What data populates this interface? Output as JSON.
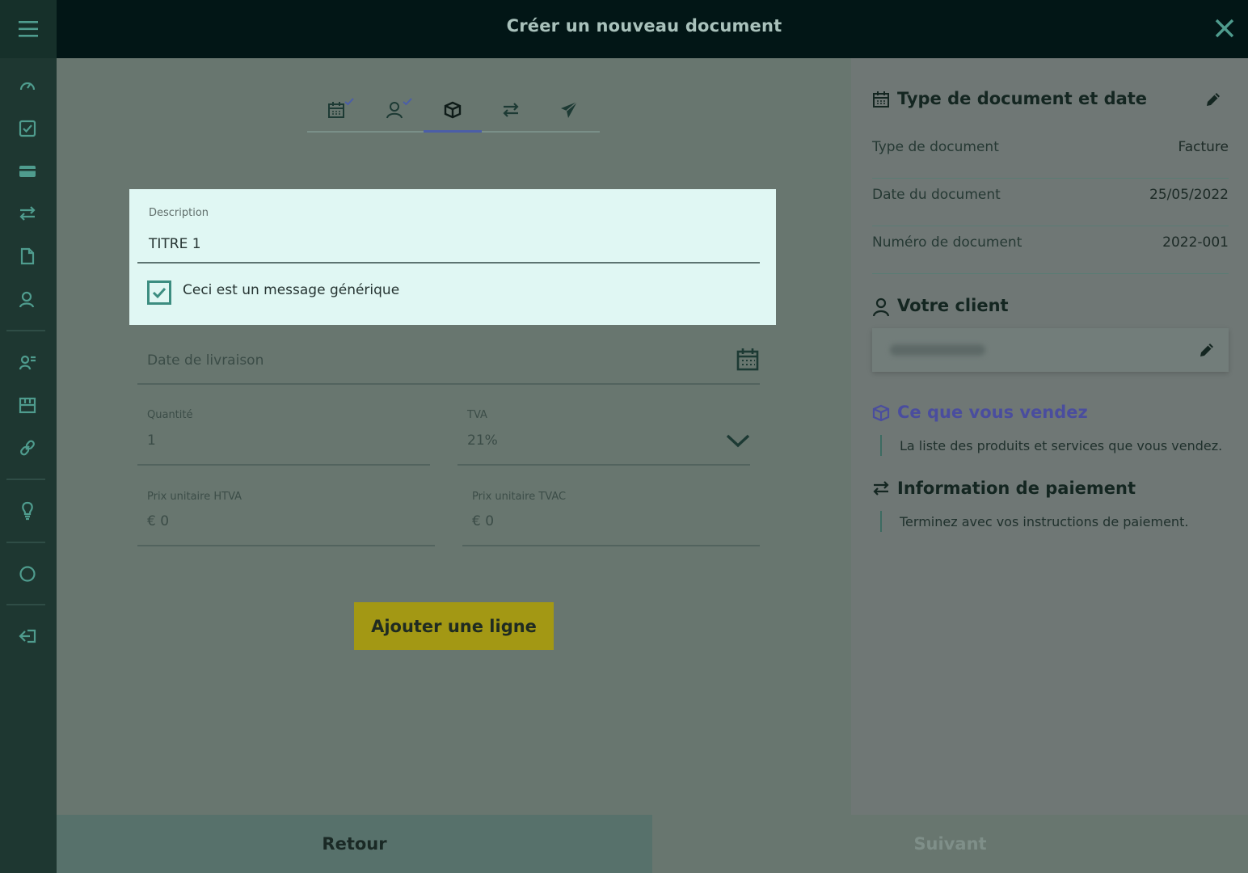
{
  "header": {
    "title": "Créer un nouveau document"
  },
  "sidebar": {
    "icons": [
      "menu-icon",
      "dashboard-icon",
      "checkbox-icon",
      "card-icon",
      "transfer-icon",
      "document-icon",
      "client-icon",
      "contacts-icon",
      "catalog-icon",
      "link-icon",
      "bulb-icon",
      "circle-icon",
      "logout-icon"
    ]
  },
  "steps": [
    {
      "icon": "calendar-icon",
      "done": true
    },
    {
      "icon": "person-icon",
      "done": true
    },
    {
      "icon": "box-icon",
      "active": true
    },
    {
      "icon": "transfer-icon"
    },
    {
      "icon": "send-icon"
    }
  ],
  "form": {
    "description_label": "Description",
    "description_value": "TITRE 1",
    "generic_label": "Ceci est un message générique",
    "generic_checked": true,
    "delivery_placeholder": "Date de livraison",
    "quantity_label": "Quantité",
    "quantity_value": "1",
    "vat_label": "TVA",
    "vat_value": "21%",
    "unit_htva_label": "Prix unitaire HTVA",
    "unit_htva_value": "€ 0",
    "unit_tvac_label": "Prix unitaire TVAC",
    "unit_tvac_value": "€ 0",
    "add_line": "Ajouter une ligne"
  },
  "summary": {
    "doc_section": "Type de document et date",
    "rows": [
      {
        "key": "Type de document",
        "value": "Facture"
      },
      {
        "key": "Date du document",
        "value": "25/05/2022"
      },
      {
        "key": "Numéro de document",
        "value": "2022-001"
      }
    ],
    "client_section": "Votre client",
    "products_section": "Ce que vous vendez",
    "products_text": "La liste des produits et services que vous vendez.",
    "payment_section": "Information de paiement",
    "payment_text": "Terminez avec vos instructions de paiement."
  },
  "footer": {
    "back": "Retour",
    "next": "Suivant"
  },
  "colors": {
    "accent_purple": "#4b5ea8",
    "button_yellow": "#a39814",
    "checkbox_teal": "#3c8d80"
  }
}
